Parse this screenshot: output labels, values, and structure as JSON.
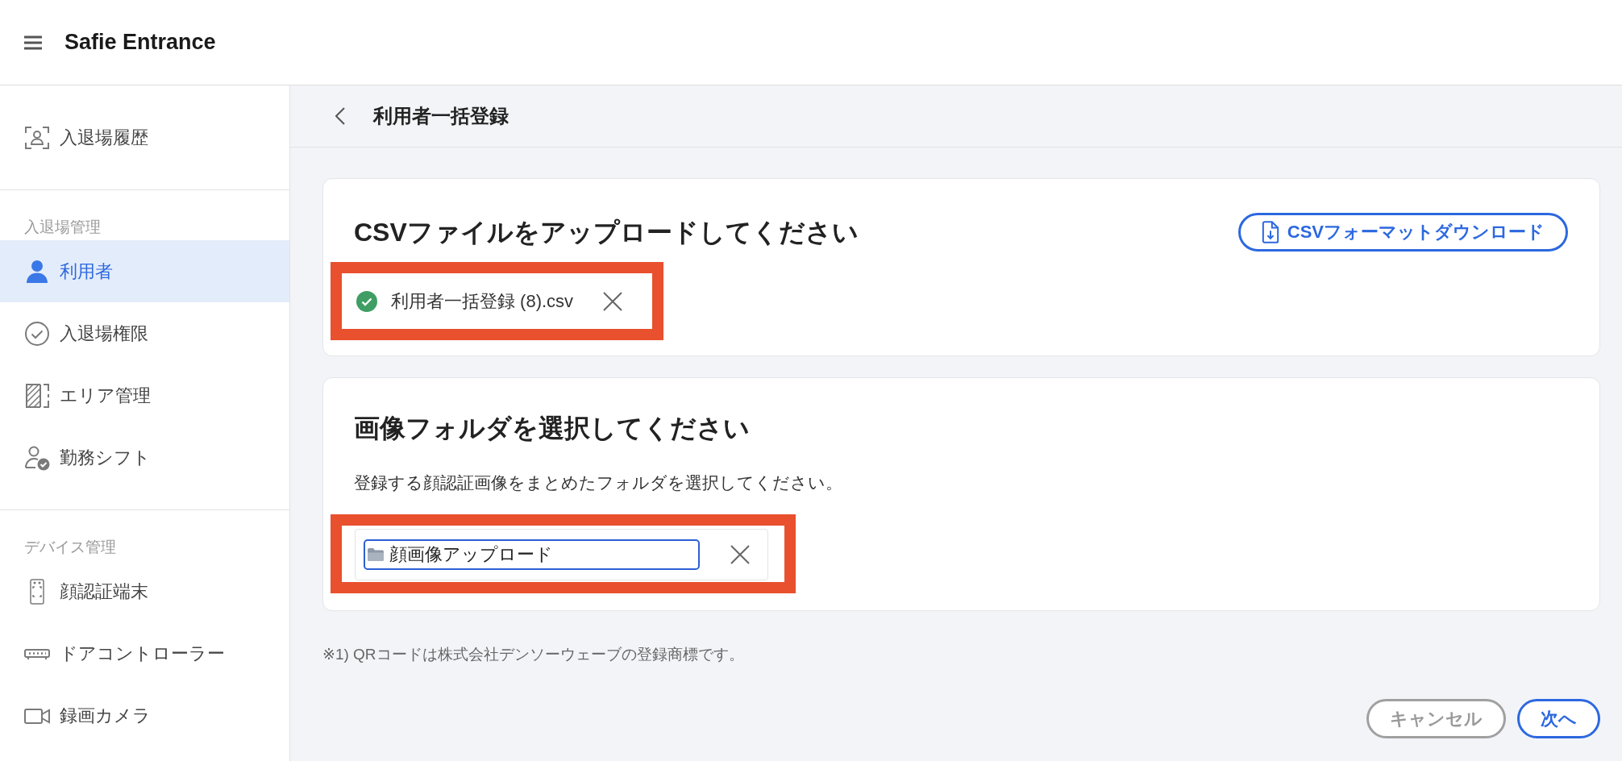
{
  "header": {
    "title": "Safie Entrance"
  },
  "sidebar": {
    "sections": [
      {
        "items": [
          {
            "label": "入退場履歴",
            "selected": false
          }
        ]
      },
      {
        "heading": "入退場管理",
        "items": [
          {
            "label": "利用者",
            "selected": true
          },
          {
            "label": "入退場権限",
            "selected": false
          },
          {
            "label": "エリア管理",
            "selected": false
          },
          {
            "label": "勤務シフト",
            "selected": false
          }
        ]
      },
      {
        "heading": "デバイス管理",
        "items": [
          {
            "label": "顔認証端末",
            "selected": false
          },
          {
            "label": "ドアコントローラー",
            "selected": false
          },
          {
            "label": "録画カメラ",
            "selected": false
          }
        ]
      }
    ]
  },
  "page": {
    "title": "利用者一括登録"
  },
  "csv_card": {
    "title": "CSVファイルをアップロードしてください",
    "download_button": "CSVフォーマットダウンロード",
    "highlighted": true,
    "file": {
      "name": "利用者一括登録 (8).csv",
      "uploaded": true
    }
  },
  "folder_card": {
    "title": "画像フォルダを選択してください",
    "description": "登録する顔認証画像をまとめたフォルダを選択してください。",
    "highlighted": true,
    "folder_field": {
      "value": "顔画像アップロード",
      "focused": true
    }
  },
  "footnote": "※1) QRコードは株式会社デンソーウェーブの登録商標です。",
  "buttons": [
    {
      "label": "キャンセル",
      "kind": "secondary"
    },
    {
      "label": "次へ",
      "kind": "primary"
    }
  ]
}
